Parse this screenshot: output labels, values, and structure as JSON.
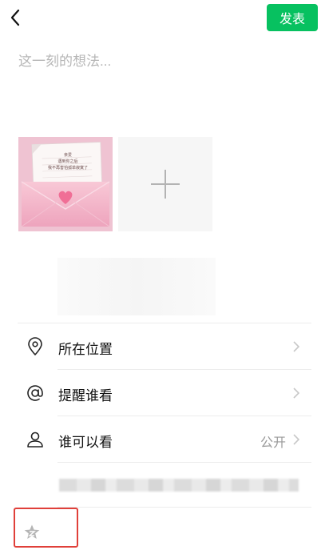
{
  "topbar": {
    "back_icon": "chevron-left-icon",
    "publish_label": "发表",
    "accent": "#07c160"
  },
  "compose": {
    "placeholder": "这一刻的想法..."
  },
  "media": {
    "photo_label": "pink envelope letter image",
    "add_icon": "plus-icon",
    "letter_lines": [
      "亲爱",
      "遇到你之后",
      "我不再害怕孤单寂寞了"
    ]
  },
  "options": [
    {
      "icon": "location-pin-icon",
      "label": "所在位置",
      "value": ""
    },
    {
      "icon": "at-sign-icon",
      "label": "提醒谁看",
      "value": ""
    },
    {
      "icon": "person-icon",
      "label": "谁可以看",
      "value": "公开"
    }
  ],
  "bottom": {
    "star_icon": "sparkle-star-icon",
    "highlight_color": "#e0403a"
  }
}
